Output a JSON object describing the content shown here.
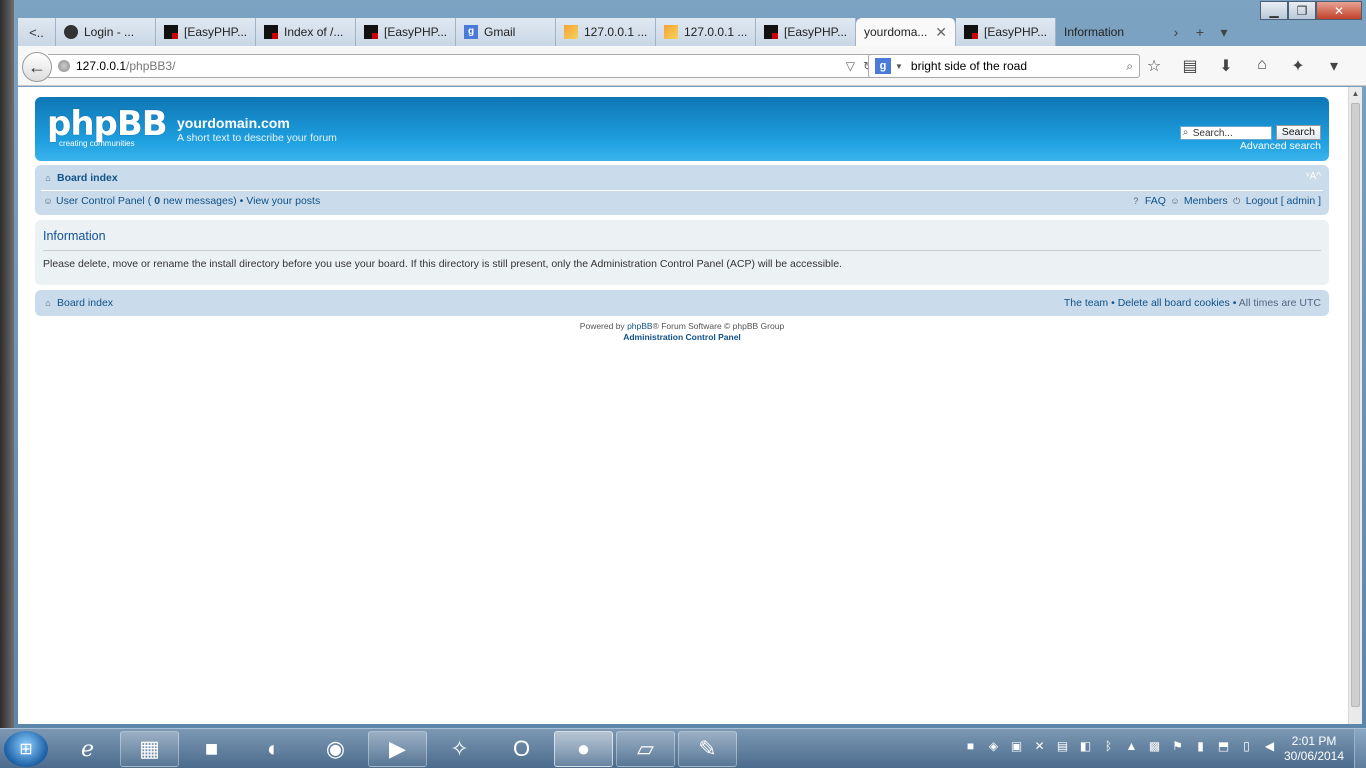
{
  "window": {
    "minimize": "▁",
    "maximize": "❐",
    "close": "✕"
  },
  "tabs": [
    {
      "label": "..",
      "icon": "arrow-left-icon"
    },
    {
      "label": "Login - ...",
      "icon": "lock-icon"
    },
    {
      "label": "[EasyPHP...",
      "icon": "easyphp-icon"
    },
    {
      "label": "Index of /...",
      "icon": "easyphp-icon"
    },
    {
      "label": "[EasyPHP...",
      "icon": "easyphp-icon"
    },
    {
      "label": "Gmail",
      "icon": "google-icon"
    },
    {
      "label": "127.0.0.1 ...",
      "icon": "phpmyadmin-icon"
    },
    {
      "label": "127.0.0.1 ...",
      "icon": "phpmyadmin-icon"
    },
    {
      "label": "[EasyPHP...",
      "icon": "easyphp-icon"
    },
    {
      "label": "yourdoma...",
      "icon": "none",
      "active": true
    },
    {
      "label": "[EasyPHP...",
      "icon": "easyphp-icon"
    },
    {
      "label": "Information",
      "icon": "none"
    }
  ],
  "urlbar": {
    "host": "127.0.0.1",
    "path": "/phpBB3/"
  },
  "searchbar": {
    "value": "bright side of the road",
    "engine_letter": "g"
  },
  "phpbb": {
    "logo": "phpBB",
    "logo_sub": "creating communities",
    "site_title": "yourdomain.com",
    "site_desc": "A short text to describe your forum",
    "search_placeholder": "Search...",
    "search_button": "Search",
    "advanced_search": "Advanced search",
    "board_index": "Board index",
    "font_size": "ᵛA^",
    "ucp": "User Control Panel",
    "msg_open": " (",
    "msg_count": "0",
    "msg_text": " new messages)",
    "sep": "•",
    "view_posts": "View your posts",
    "faq": "FAQ",
    "members": "Members",
    "logout": "Logout [ admin ]",
    "info_title": "Information",
    "info_text": "Please delete, move or rename the install directory before you use your board. If this directory is still present, only the Administration Control Panel (ACP) will be accessible.",
    "footer_board_index": "Board index",
    "the_team": "The team",
    "delete_cookies": "Delete all board cookies",
    "times": "All times are UTC",
    "powered_by": "Powered by",
    "phpbb_link": "phpBB",
    "powered_rest": "® Forum Software © phpBB Group",
    "acp": "Administration Control Panel"
  },
  "taskbar": {
    "time": "2:01 PM",
    "date": "30/06/2014"
  }
}
